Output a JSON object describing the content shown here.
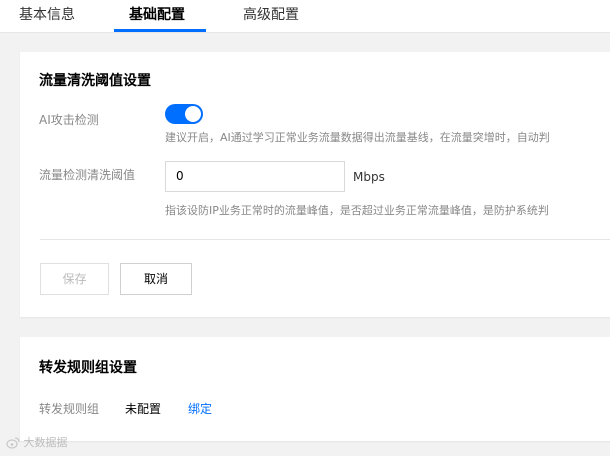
{
  "tabs": [
    {
      "label": "基本信息",
      "active": false
    },
    {
      "label": "基础配置",
      "active": true
    },
    {
      "label": "高级配置",
      "active": false
    }
  ],
  "threshold_card": {
    "title": "流量清洗阈值设置",
    "ai_detect": {
      "label": "AI攻击检测",
      "enabled": true,
      "hint": "建议开启，AI通过学习正常业务流量数据得出流量基线，在流量突增时，自动判"
    },
    "threshold": {
      "label": "流量检测清洗阈值",
      "value": "0",
      "unit": "Mbps",
      "hint": "指该设防IP业务正常时的流量峰值，是否超过业务正常流量峰值，是防护系统判"
    },
    "save_label": "保存",
    "cancel_label": "取消"
  },
  "forward_card": {
    "title": "转发规则组设置",
    "rule_group": {
      "label": "转发规则组",
      "value": "未配置",
      "link": "绑定"
    }
  },
  "watermark": "大数据据",
  "colors": {
    "accent": "#006eff",
    "background": "#f2f2f2"
  }
}
